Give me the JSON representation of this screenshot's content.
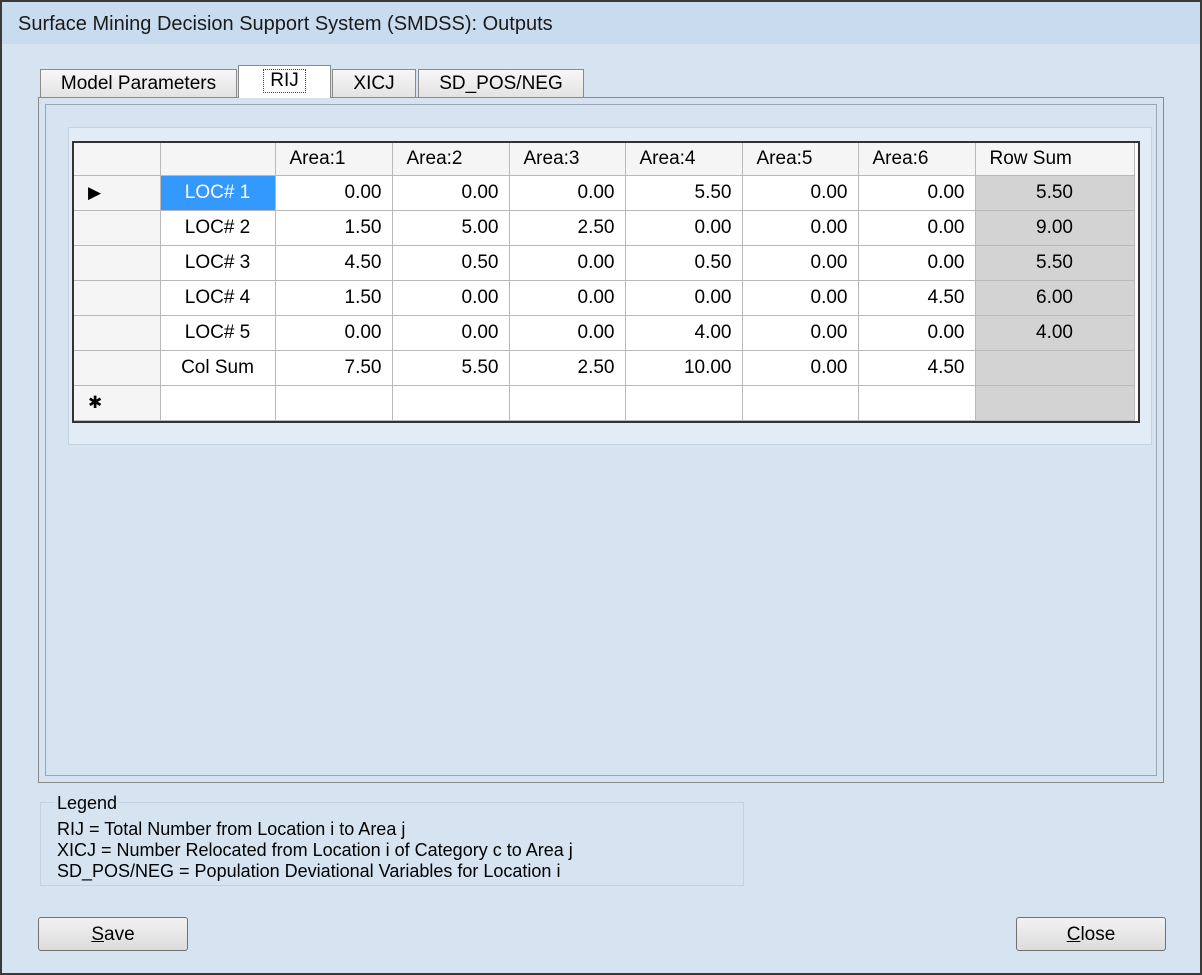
{
  "window": {
    "title": "Surface Mining Decision Support System (SMDSS): Outputs"
  },
  "tabs": [
    {
      "label": "Model Parameters"
    },
    {
      "label": "RIJ"
    },
    {
      "label": "XICJ"
    },
    {
      "label": "SD_POS/NEG"
    }
  ],
  "active_tab": "RIJ",
  "grid": {
    "columns": [
      "",
      "Area:1",
      "Area:2",
      "Area:3",
      "Area:4",
      "Area:5",
      "Area:6",
      "Row Sum"
    ],
    "row_indicator": "▶",
    "new_row_indicator": "✱",
    "rows": [
      {
        "label": "LOC# 1",
        "values": [
          "0.00",
          "0.00",
          "0.00",
          "5.50",
          "0.00",
          "0.00"
        ],
        "row_sum": "5.50"
      },
      {
        "label": "LOC# 2",
        "values": [
          "1.50",
          "5.00",
          "2.50",
          "0.00",
          "0.00",
          "0.00"
        ],
        "row_sum": "9.00"
      },
      {
        "label": "LOC# 3",
        "values": [
          "4.50",
          "0.50",
          "0.00",
          "0.50",
          "0.00",
          "0.00"
        ],
        "row_sum": "5.50"
      },
      {
        "label": "LOC# 4",
        "values": [
          "1.50",
          "0.00",
          "0.00",
          "0.00",
          "0.00",
          "4.50"
        ],
        "row_sum": "6.00"
      },
      {
        "label": "LOC# 5",
        "values": [
          "0.00",
          "0.00",
          "0.00",
          "4.00",
          "0.00",
          "0.00"
        ],
        "row_sum": "4.00"
      },
      {
        "label": "Col Sum",
        "values": [
          "7.50",
          "5.50",
          "2.50",
          "10.00",
          "0.00",
          "4.50"
        ],
        "row_sum": ""
      }
    ]
  },
  "legend": {
    "title": "Legend",
    "lines": [
      "RIJ = Total Number from Location i to Area j",
      "XICJ = Number Relocated from Location i of Category c to Area j",
      "SD_POS/NEG = Population Deviational Variables for Location i"
    ]
  },
  "buttons": {
    "save_mnemonic": "S",
    "save_rest": "ave",
    "close_mnemonic": "C",
    "close_rest": "lose"
  },
  "colors": {
    "selection": "#3399ff",
    "window_bg": "#d6e4f2",
    "rowsum_bg": "#d3d3d3"
  }
}
